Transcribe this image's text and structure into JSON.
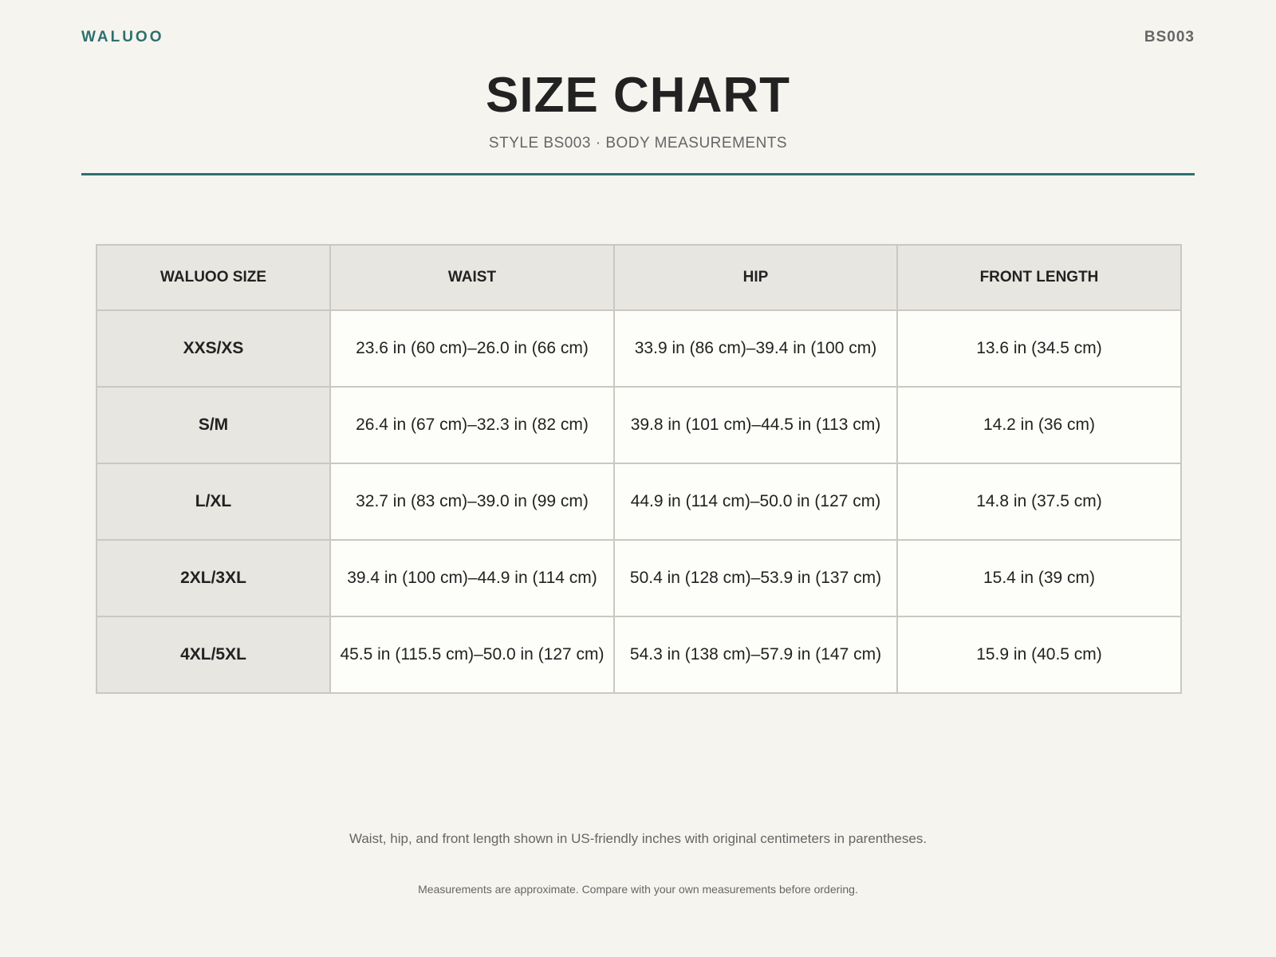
{
  "header": {
    "brand": "WALUOO",
    "code": "BS003",
    "title": "SIZE CHART",
    "subtitle": "STYLE BS003 · BODY MEASUREMENTS"
  },
  "colors": {
    "accent": "#2e6f6f",
    "background": "#f5f4ef",
    "header_cell": "#e8e6e0"
  },
  "table": {
    "headers": [
      "WALUOO SIZE",
      "WAIST",
      "HIP",
      "FRONT LENGTH"
    ],
    "rows": [
      {
        "size": "XXS/XS",
        "waist": "23.6 in (60 cm)–26.0 in (66 cm)",
        "hip": "33.9 in (86 cm)–39.4 in (100 cm)",
        "front_length": "13.6 in (34.5 cm)"
      },
      {
        "size": "S/M",
        "waist": "26.4 in (67 cm)–32.3 in (82 cm)",
        "hip": "39.8 in (101 cm)–44.5 in (113 cm)",
        "front_length": "14.2 in (36 cm)"
      },
      {
        "size": "L/XL",
        "waist": "32.7 in (83 cm)–39.0 in (99 cm)",
        "hip": "44.9 in (114 cm)–50.0 in (127 cm)",
        "front_length": "14.8 in (37.5 cm)"
      },
      {
        "size": "2XL/3XL",
        "waist": "39.4 in (100 cm)–44.9 in (114 cm)",
        "hip": "50.4 in (128 cm)–53.9 in (137 cm)",
        "front_length": "15.4 in (39 cm)"
      },
      {
        "size": "4XL/5XL",
        "waist": "45.5 in (115.5 cm)–50.0 in (127 cm)",
        "hip": "54.3 in (138 cm)–57.9 in (147 cm)",
        "front_length": "15.9 in (40.5 cm)"
      }
    ]
  },
  "footer": {
    "note": "Waist, hip, and front length shown in US-friendly inches with original centimeters in parentheses.",
    "disclaimer": "Measurements are approximate. Compare with your own measurements before ordering."
  }
}
